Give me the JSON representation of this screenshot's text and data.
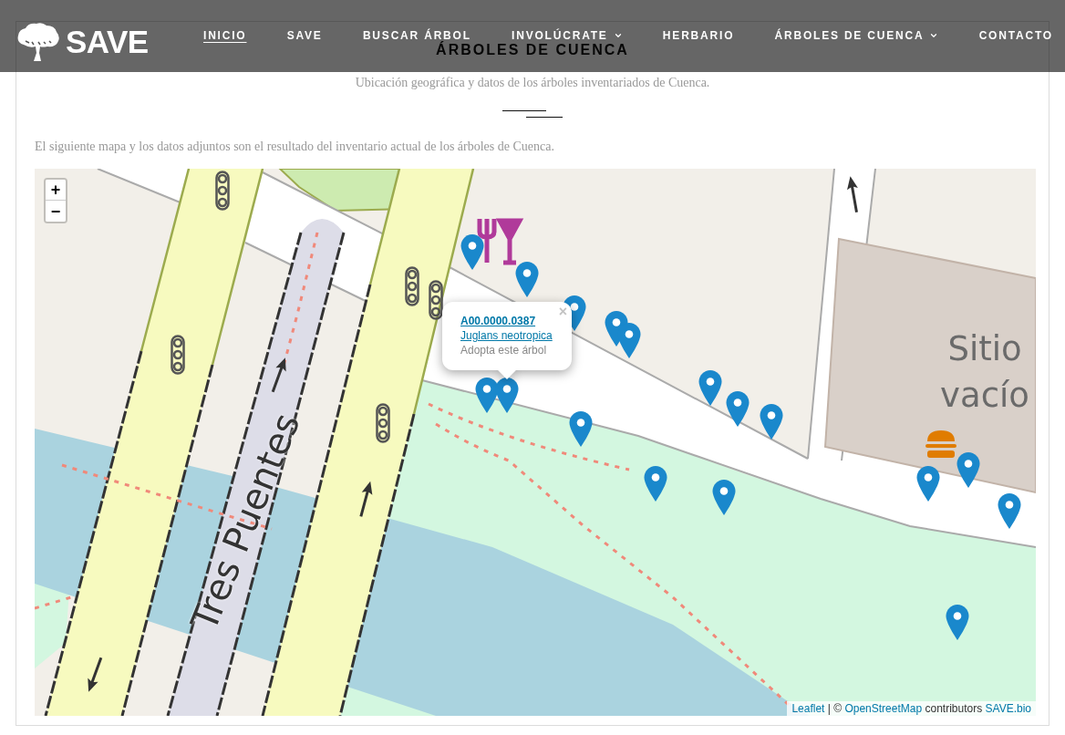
{
  "header": {
    "logo": {
      "text": "SAVE"
    },
    "nav": [
      {
        "label": "INICIO",
        "selected": true,
        "dropdown": false
      },
      {
        "label": "SAVE",
        "selected": false,
        "dropdown": false
      },
      {
        "label": "BUSCAR ÁRBOL",
        "selected": false,
        "dropdown": false
      },
      {
        "label": "INVOLÚCRATE",
        "selected": false,
        "dropdown": true
      },
      {
        "label": "HERBARIO",
        "selected": false,
        "dropdown": false
      },
      {
        "label": "ÁRBOLES DE CUENCA",
        "selected": false,
        "dropdown": true
      },
      {
        "label": "CONTACTO",
        "selected": false,
        "dropdown": false
      }
    ]
  },
  "content": {
    "title": "ÁRBOLES DE CUENCA",
    "subtitle": "Ubicación geográfica y datos de los árboles inventariados de Cuenca.",
    "intro": "El siguiente mapa y los datos adjuntos son el resultado del inventario actual de los árboles de Cuenca."
  },
  "map": {
    "zoom": {
      "in": "+",
      "out": "−"
    },
    "labels": [
      {
        "kind": "street",
        "text": "Tres Puentes"
      },
      {
        "kind": "place",
        "text": "Sitio vacío"
      }
    ],
    "popup": {
      "close": "×",
      "code": "A00.0000.0387",
      "species": "Juglans neotropica",
      "action": "Adopta este árbol"
    },
    "attribution": [
      {
        "kind": "link",
        "text": "Leaflet"
      },
      {
        "kind": "text",
        "text": " | © "
      },
      {
        "kind": "link",
        "text": "OpenStreetMap"
      },
      {
        "kind": "text",
        "text": " contributors "
      },
      {
        "kind": "link",
        "text": "SAVE.bio"
      }
    ]
  }
}
